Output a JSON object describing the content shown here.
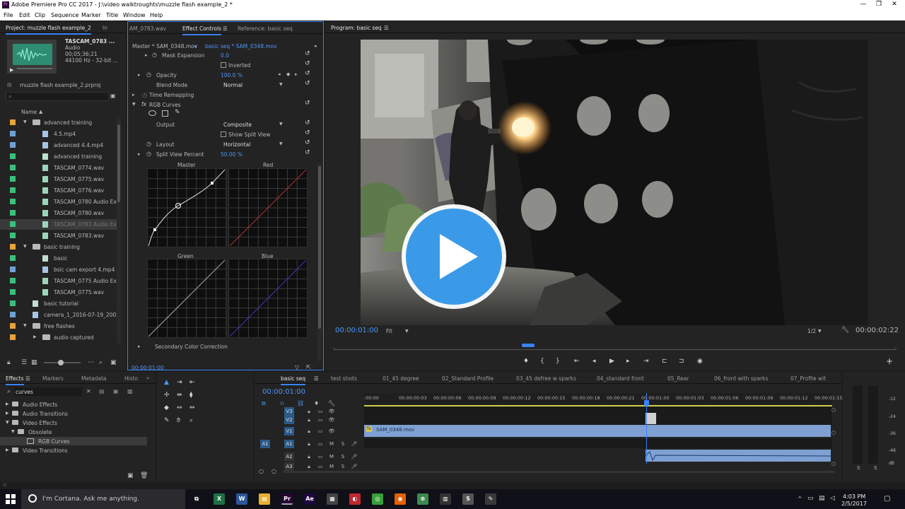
{
  "window": {
    "title": "Adobe Premiere Pro CC 2017 - J:\\video walktroughts\\muzzle flash example_2 *",
    "app_badge": "Pr",
    "controls": [
      "—",
      "❐",
      "✕"
    ]
  },
  "menu": [
    "File",
    "Edit",
    "Clip",
    "Sequence",
    "Marker",
    "Title",
    "Window",
    "Help"
  ],
  "project": {
    "tabs": [
      "Project: muzzle flash example_2",
      "In"
    ],
    "clip_name": "TASCAM_0783 ...",
    "clip_type": "Audio",
    "clip_duration": "00;05;36;21",
    "clip_format": "44100 Hz - 32-bit ...",
    "project_file": "muzzle flash example_2.prproj",
    "column_header": "Name",
    "items": [
      {
        "label": "advanced training",
        "type": "folder",
        "indent": 1,
        "color": "#e8a33a",
        "expanded": true
      },
      {
        "label": "4.5.mp4",
        "type": "video",
        "indent": 2,
        "color": "#6f9fd6"
      },
      {
        "label": "advanced 4.4.mp4",
        "type": "video",
        "indent": 2,
        "color": "#6f9fd6"
      },
      {
        "label": "advanced training",
        "type": "sequence",
        "indent": 2,
        "color": "#3bbf7a"
      },
      {
        "label": "TASCAM_0774.wav",
        "type": "audio",
        "indent": 2,
        "color": "#3bbf7a"
      },
      {
        "label": "TASCAM_0775.wav",
        "type": "audio",
        "indent": 2,
        "color": "#3bbf7a"
      },
      {
        "label": "TASCAM_0776.wav",
        "type": "audio",
        "indent": 2,
        "color": "#3bbf7a"
      },
      {
        "label": "TASCAM_0780 Audio Extr",
        "type": "audio",
        "indent": 2,
        "color": "#3bbf7a"
      },
      {
        "label": "TASCAM_0780.wav",
        "type": "audio",
        "indent": 2,
        "color": "#3bbf7a"
      },
      {
        "label": "TASCAM_0783 Audio Extr",
        "type": "audio",
        "indent": 2,
        "color": "#3bbf7a",
        "selected": true
      },
      {
        "label": "TASCAM_0783.wav",
        "type": "audio",
        "indent": 2,
        "color": "#3bbf7a"
      },
      {
        "label": "basic training",
        "type": "folder",
        "indent": 1,
        "color": "#e8a33a",
        "expanded": true
      },
      {
        "label": "basic",
        "type": "sequence",
        "indent": 2,
        "color": "#3bbf7a"
      },
      {
        "label": "bsic cam export 4.mp4",
        "type": "video",
        "indent": 2,
        "color": "#6f9fd6"
      },
      {
        "label": "TASCAM_0775 Audio Extr",
        "type": "audio",
        "indent": 2,
        "color": "#3bbf7a"
      },
      {
        "label": "TASCAM_0775.wav",
        "type": "audio",
        "indent": 2,
        "color": "#3bbf7a"
      },
      {
        "label": "basic tutorial",
        "type": "sequence",
        "indent": 1,
        "color": "#3bbf7a"
      },
      {
        "label": "camera_1_2016-07-19_2007_",
        "type": "video",
        "indent": 1,
        "color": "#6f9fd6"
      },
      {
        "label": "free flashes",
        "type": "folder",
        "indent": 1,
        "color": "#e8a33a",
        "expanded": true
      },
      {
        "label": "audio captured",
        "type": "folder",
        "indent": 2,
        "color": "#e8a33a"
      }
    ]
  },
  "effect_controls": {
    "tabs": [
      "AM_0783.wav",
      "Effect Controls",
      "Reference: basic seq"
    ],
    "master_clip": "Master * SAM_0348.mov",
    "sequence_clip": "basic seq * SAM_0348.mov",
    "mask_expansion_label": "Mask Expansion",
    "mask_expansion_value": "0.0",
    "inverted_label": "Inverted",
    "opacity_label": "Opacity",
    "opacity_value": "100.0 %",
    "blend_mode_label": "Blend Mode",
    "blend_mode_value": "Normal",
    "time_remapping_label": "Time Remapping",
    "rgb_curves_label": "RGB Curves",
    "output_label": "Output",
    "output_value": "Composite",
    "show_split_view_label": "Show Split View",
    "layout_label": "Layout",
    "layout_value": "Horizontal",
    "split_percent_label": "Split View Percent",
    "split_percent_value": "50.00 %",
    "curve_labels": [
      "Master",
      "Red",
      "Green",
      "Blue"
    ],
    "secondary_label": "Secondary Color Correction",
    "timecode": "00:00:01:00"
  },
  "program": {
    "tab": "Program: basic seq",
    "timecode": "00:00:01:00",
    "fit": "Fit",
    "resolution": "1/2",
    "duration": "00:00:02:22",
    "transport": [
      "♦",
      "{",
      "}",
      "⇤",
      "◂",
      "▶",
      "▸",
      "⇥",
      "⊏",
      "⊐",
      "◉"
    ],
    "add": "+"
  },
  "effects": {
    "tabs": [
      "Effects",
      "Markers",
      "Metadata",
      "Histo"
    ],
    "search_value": "curves",
    "tree": [
      {
        "label": "Audio Effects",
        "indent": 0
      },
      {
        "label": "Audio Transitions",
        "indent": 0
      },
      {
        "label": "Video Effects",
        "indent": 0,
        "expanded": true
      },
      {
        "label": "Obsolete",
        "indent": 1,
        "expanded": true
      },
      {
        "label": "RGB Curves",
        "indent": 2,
        "selected": true
      },
      {
        "label": "Video Transitions",
        "indent": 0
      }
    ]
  },
  "timeline": {
    "tabs": [
      "basic seq",
      "test shots",
      "01_45 degree",
      "02_Standard Profile",
      "03_45 defree w sparks",
      "04_standard front",
      "05_Rear",
      "06_front with sparks",
      "07_Profile wit"
    ],
    "timecode": "00:00:01:00",
    "ticks": [
      ":00:00",
      "00:00:00:03",
      "00:00:00:06",
      "00:00:00:09",
      "00:00:00:12",
      "00:00:00:15",
      "00:00:00:18",
      "00:00:00:21",
      "00:00:01:00",
      "00:00:01:03",
      "00:00:01:06",
      "00:00:01:09",
      "00:00:01:12",
      "00:00:01:15"
    ],
    "tracks": [
      "V3",
      "V2",
      "V1",
      "A1",
      "A2",
      "A3"
    ],
    "source_track": "A1",
    "clip_v1": "SAM_0348.mov",
    "fx_badge": "fx",
    "playhead_fraction": 0.603
  },
  "meter": {
    "labels": [
      "-12",
      "-24",
      "-36",
      "-48",
      "dB"
    ],
    "solo": [
      "S",
      "S"
    ]
  },
  "taskbar": {
    "search_placeholder": "I'm Cortana. Ask me anything.",
    "apps": [
      {
        "name": "task-view",
        "glyph": "⧉",
        "color": "#101018"
      },
      {
        "name": "excel",
        "glyph": "X",
        "color": "#1e7145"
      },
      {
        "name": "word",
        "glyph": "W",
        "color": "#2b579a"
      },
      {
        "name": "file-explorer",
        "glyph": "▤",
        "color": "#e8b030"
      },
      {
        "name": "premiere",
        "glyph": "Pr",
        "color": "#2a0634"
      },
      {
        "name": "after-effects",
        "glyph": "Ae",
        "color": "#1f0740"
      },
      {
        "name": "calculator",
        "glyph": "▦",
        "color": "#444"
      },
      {
        "name": "davinci",
        "glyph": "◐",
        "color": "#c0282d"
      },
      {
        "name": "chrome",
        "glyph": "◎",
        "color": "#3a9e3a"
      },
      {
        "name": "firefox",
        "glyph": "◉",
        "color": "#e66000"
      },
      {
        "name": "globe",
        "glyph": "⊕",
        "color": "#3c8a4e"
      },
      {
        "name": "notebook",
        "glyph": "▥",
        "color": "#333"
      },
      {
        "name": "sketch",
        "glyph": "S",
        "color": "#555"
      },
      {
        "name": "toolbox",
        "glyph": "✎",
        "color": "#3a3a3a"
      }
    ],
    "time": "4:03 PM",
    "date": "2/5/2017"
  }
}
